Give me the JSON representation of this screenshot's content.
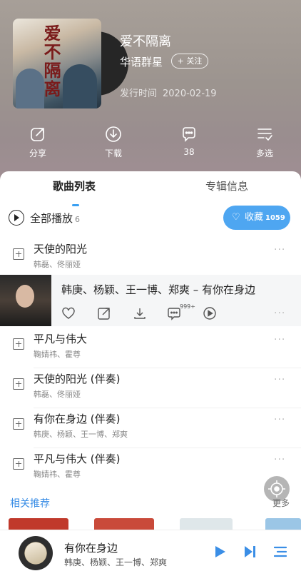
{
  "album": {
    "title": "爱不隔离",
    "artist": "华语群星",
    "follow_label": "+ 关注",
    "release_label": "发行时间",
    "release_date": "2020-02-19",
    "cover_text": "爱不隔离"
  },
  "actions": [
    {
      "label": "分享",
      "icon": "share-icon"
    },
    {
      "label": "下载",
      "icon": "download-icon"
    },
    {
      "label": "38",
      "icon": "comment-icon"
    },
    {
      "label": "多选",
      "icon": "multi-select-icon"
    }
  ],
  "tabs": [
    {
      "label": "歌曲列表",
      "active": true
    },
    {
      "label": "专辑信息",
      "active": false
    }
  ],
  "play_all": {
    "label": "全部播放",
    "count": "6"
  },
  "collect": {
    "label": "收藏",
    "count": "1059"
  },
  "songs": [
    {
      "title": "天使的阳光",
      "singers": "韩磊、佟丽娅"
    },
    {
      "title": "韩庚、杨颖、王一博、郑爽 – 有你在身边",
      "singers": "",
      "expanded": true,
      "comment_badge": "999+"
    },
    {
      "title": "平凡与伟大",
      "singers": "鞠婧祎、霍尊"
    },
    {
      "title": "天使的阳光 (伴奏)",
      "singers": "韩磊、佟丽娅"
    },
    {
      "title": "有你在身边 (伴奏)",
      "singers": "韩庚、杨颖、王一博、郑爽"
    },
    {
      "title": "平凡与伟大 (伴奏)",
      "singers": "鞠婧祎、霍尊"
    }
  ],
  "more_glyph": "···",
  "related": {
    "label": "相关推荐",
    "more": "更多"
  },
  "player": {
    "title": "有你在身边",
    "artists": "韩庚、杨颖、王一博、郑爽"
  },
  "colors": {
    "accent": "#3aa0f2",
    "collect_bg": "#4ea6f1"
  }
}
